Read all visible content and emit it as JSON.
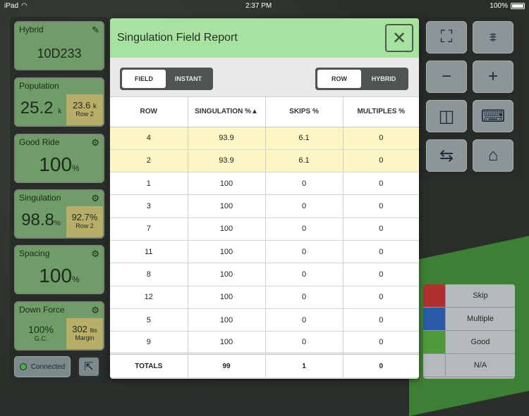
{
  "statusbar": {
    "device": "iPad",
    "time": "2:37 PM",
    "battery": "100%"
  },
  "left_tiles": {
    "hybrid": {
      "title": "Hybrid",
      "value": "10D233"
    },
    "population": {
      "title": "Population",
      "value": "25.2",
      "unit": "k",
      "row_value": "23.6",
      "row_unit": "k",
      "row_label": "Row 2"
    },
    "good_ride": {
      "title": "Good Ride",
      "value": "100",
      "unit": "%"
    },
    "singulation": {
      "title": "Singulation",
      "value": "98.8",
      "unit": "%",
      "row_value": "92.7%",
      "row_label": "Row 2"
    },
    "spacing": {
      "title": "Spacing",
      "value": "100",
      "unit": "%"
    },
    "down_force": {
      "title": "Down Force",
      "left_value": "100%",
      "left_label": "G.C.",
      "right_value": "302",
      "right_unit": "lbs",
      "right_label": "Margin"
    }
  },
  "connection": {
    "label": "Connected"
  },
  "modal": {
    "title": "Singulation Field Report",
    "seg_left": [
      "FIELD",
      "INSTANT"
    ],
    "seg_right": [
      "ROW",
      "HYBRID"
    ],
    "columns": [
      "ROW",
      "SINGULATION %▲",
      "SKIPS %",
      "MULTIPLES %"
    ],
    "rows": [
      {
        "row": "4",
        "singulation": "93.9",
        "skips": "6.1",
        "multiples": "0"
      },
      {
        "row": "2",
        "singulation": "93.9",
        "skips": "6.1",
        "multiples": "0"
      },
      {
        "row": "1",
        "singulation": "100",
        "skips": "0",
        "multiples": "0"
      },
      {
        "row": "3",
        "singulation": "100",
        "skips": "0",
        "multiples": "0"
      },
      {
        "row": "7",
        "singulation": "100",
        "skips": "0",
        "multiples": "0"
      },
      {
        "row": "11",
        "singulation": "100",
        "skips": "0",
        "multiples": "0"
      },
      {
        "row": "8",
        "singulation": "100",
        "skips": "0",
        "multiples": "0"
      },
      {
        "row": "12",
        "singulation": "100",
        "skips": "0",
        "multiples": "0"
      },
      {
        "row": "5",
        "singulation": "100",
        "skips": "0",
        "multiples": "0"
      },
      {
        "row": "9",
        "singulation": "100",
        "skips": "0",
        "multiples": "0"
      }
    ],
    "totals": {
      "label": "TOTALS",
      "singulation": "99",
      "skips": "1",
      "multiples": "0"
    }
  },
  "legend": [
    {
      "label": "Skip",
      "color": "#b03030"
    },
    {
      "label": "Multiple",
      "color": "#2a5aa8"
    },
    {
      "label": "Good",
      "color": "#4f9a3a"
    },
    {
      "label": "N/A",
      "color": "#b4babc"
    }
  ]
}
